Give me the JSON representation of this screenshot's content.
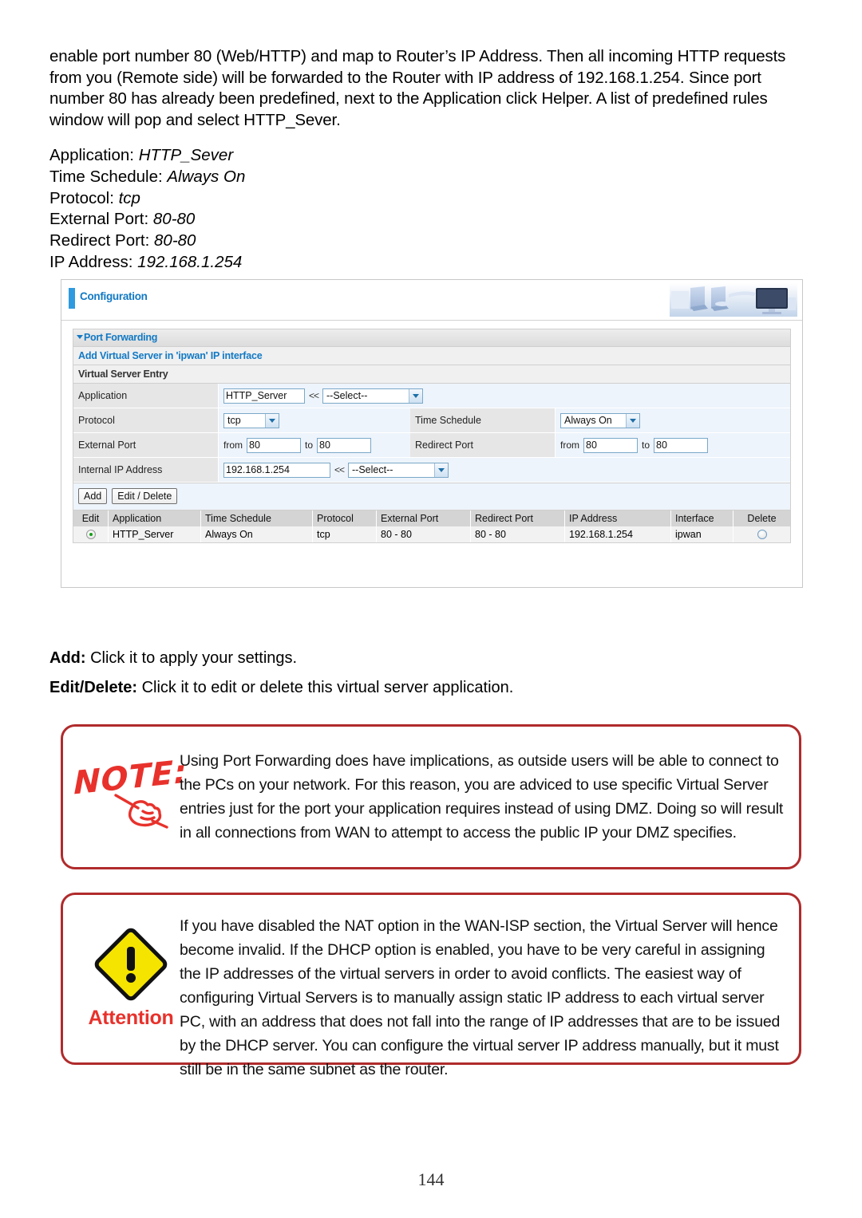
{
  "body_text": {
    "intro": "enable port number 80 (Web/HTTP) and map to Router’s IP Address.  Then all incoming HTTP requests from you (Remote side) will be forwarded to the Router with IP address of 192.168.1.254. Since port number 80 has already been predefined, next to the Application click Helper.  A list of predefined rules window will pop and select HTTP_Sever."
  },
  "param_list": [
    {
      "label": "Application:",
      "value": "HTTP_Sever"
    },
    {
      "label": "Time Schedule:",
      "value": "Always On"
    },
    {
      "label": "Protocol:",
      "value": "tcp"
    },
    {
      "label": "External Port:",
      "value": "80-80"
    },
    {
      "label": "Redirect Port:",
      "value": "80-80"
    },
    {
      "label": "IP Address:",
      "value": "192.168.1.254"
    }
  ],
  "router_ui": {
    "configuration_title": "Configuration",
    "section_title": "Port Forwarding",
    "subsection_title": "Add Virtual Server in 'ipwan' IP interface",
    "entry_title": "Virtual Server Entry",
    "form": {
      "application_label": "Application",
      "application_value": "HTTP_Server",
      "application_select": "--Select--",
      "arrows": "<<",
      "protocol_label": "Protocol",
      "protocol_value": "tcp",
      "time_schedule_label": "Time Schedule",
      "time_schedule_value": "Always On",
      "external_port_label": "External Port",
      "external_from_label": "from",
      "external_from_value": "80",
      "external_to_label": "to",
      "external_to_value": "80",
      "redirect_port_label": "Redirect Port",
      "redirect_from_label": "from",
      "redirect_from_value": "80",
      "redirect_to_label": "to",
      "redirect_to_value": "80",
      "internal_ip_label": "Internal IP Address",
      "internal_ip_value": "192.168.1.254",
      "internal_ip_select": "--Select--"
    },
    "buttons": {
      "add": "Add",
      "edit_delete": "Edit / Delete"
    },
    "table": {
      "headers": [
        "Edit",
        "Application",
        "Time Schedule",
        "Protocol",
        "External Port",
        "Redirect Port",
        "IP Address",
        "Interface",
        "Delete"
      ],
      "rows": [
        {
          "edit_selected": true,
          "application": "HTTP_Server",
          "time_schedule": "Always On",
          "protocol": "tcp",
          "external_port": "80 - 80",
          "redirect_port": "80 - 80",
          "ip_address": "192.168.1.254",
          "interface": "ipwan",
          "delete_selected": false
        }
      ]
    }
  },
  "descriptions": {
    "add_term": "Add:",
    "add_text": " Click it to apply your settings.",
    "editdelete_term": "Edit/Delete:",
    "editdelete_text": " Click it to edit or delete this virtual server application."
  },
  "note_box": {
    "icon_label": "NOTE:",
    "text": "Using Port Forwarding does have implications, as outside users will be able to connect to the PCs on your network. For this reason, you are adviced to use specific Virtual Server entries just for the port your application requires instead of using DMZ. Doing so will result in all connections from WAN to attempt to access the public IP your DMZ specifies."
  },
  "attention_box": {
    "icon_label": "Attention",
    "text": "If you have disabled the NAT option in the WAN-ISP section, the Virtual Server will hence become invalid. If the DHCP option is enabled, you have to be very careful in assigning the IP addresses of the virtual servers in order to avoid conflicts. The easiest way of configuring Virtual Servers is to manually assign static IP address to each virtual server PC, with an address that does not fall into the range of IP addresses that are to be issued by the DHCP server. You can configure the virtual server IP address manually, but it must still be in the same subnet as the router."
  },
  "page_number": "144",
  "colors": {
    "link_blue": "#1279c4",
    "accent_blue": "#2e9ae0",
    "note_red": "#b02b2c",
    "warn_yellow": "#f5e400",
    "radio_green": "#15a015"
  }
}
